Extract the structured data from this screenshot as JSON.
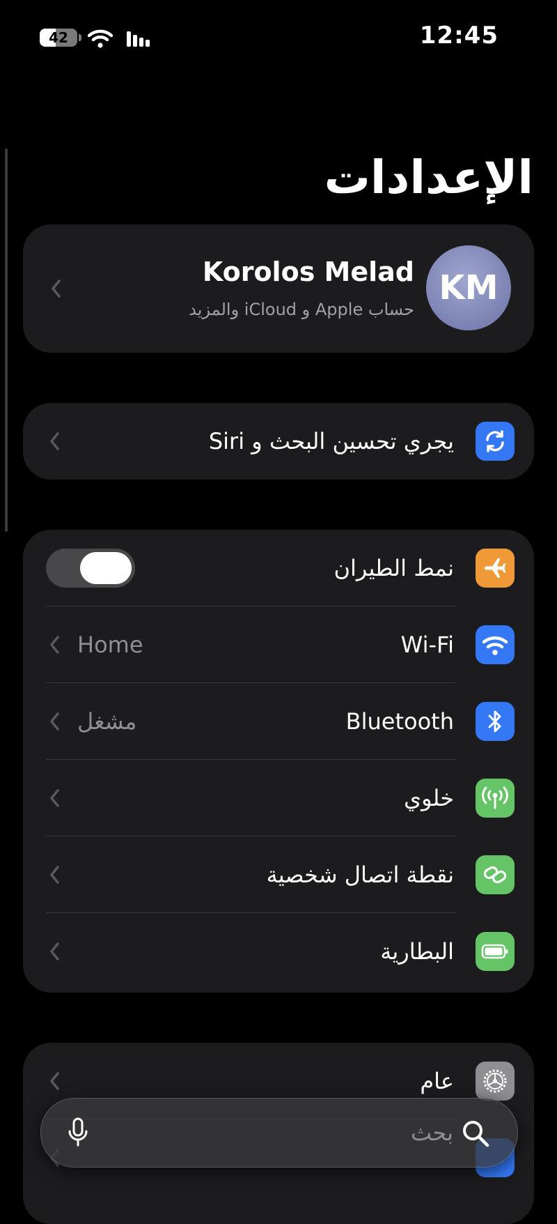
{
  "status_bar": {
    "battery_level": "42",
    "battery_fill_fraction": 0.42,
    "time": "12:45"
  },
  "page": {
    "title": "الإعدادات"
  },
  "account": {
    "initials": "KM",
    "name": "Korolos Melad",
    "subtitle": "حساب Apple و iCloud والمزيد"
  },
  "suggestion": {
    "label": "يجري تحسين البحث و Siri",
    "icon": "sync-icon",
    "icon_color": "#3478f6"
  },
  "connectivity": [
    {
      "label": "نمط الطيران",
      "icon": "airplane-icon",
      "icon_color": "#f09a37",
      "toggle": true,
      "toggle_on": false
    },
    {
      "label": "Wi-Fi",
      "value": "Home",
      "icon": "wifi-icon",
      "icon_color": "#3478f6"
    },
    {
      "label": "Bluetooth",
      "value": "مشغل",
      "icon": "bluetooth-icon",
      "icon_color": "#3478f6"
    },
    {
      "label": "خلوي",
      "icon": "cellular-icon",
      "icon_color": "#65c466"
    },
    {
      "label": "نقطة اتصال شخصية",
      "icon": "hotspot-icon",
      "icon_color": "#65c466"
    },
    {
      "label": "البطارية",
      "icon": "battery-icon",
      "icon_color": "#65c466"
    }
  ],
  "general": [
    {
      "label": "عام",
      "icon": "gear-icon",
      "icon_color": "#8e8e93"
    }
  ],
  "search": {
    "placeholder": "بحث"
  }
}
